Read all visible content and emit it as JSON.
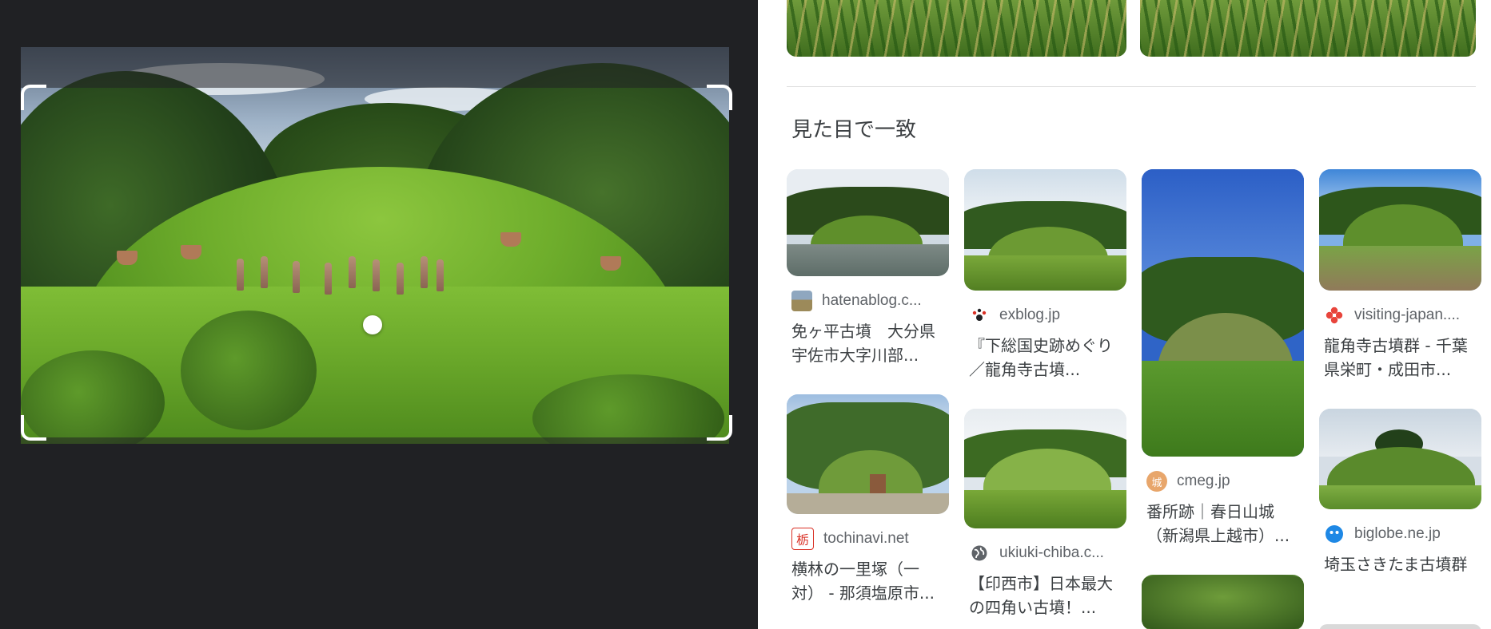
{
  "section": {
    "title": "見た目で一致"
  },
  "results": [
    {
      "source": "hatenablog.c...",
      "title": "免ヶ平古墳　大分県宇佐市大字川部...",
      "favicon": "landscape-favicon-icon"
    },
    {
      "source": "exblog.jp",
      "title": "『下総国史跡めぐり／龍角寺古墳...",
      "favicon": "paw-favicon-icon"
    },
    {
      "source": "cmeg.jp",
      "title": "番所跡｜春日山城（新潟県上越市）...",
      "favicon": "castle-favicon-icon",
      "favicon_text": "城"
    },
    {
      "source": "visiting-japan....",
      "title": "龍角寺古墳群 - 千葉県栄町・成田市...",
      "favicon": "flower-favicon-icon"
    },
    {
      "source": "tochinavi.net",
      "title": "横林の一里塚（一対） - 那須塩原市...",
      "favicon": "tochigi-favicon-icon",
      "favicon_text": "栃"
    },
    {
      "source": "ukiuki-chiba.c...",
      "title": "【印西市】日本最大の四角い古墳！...",
      "favicon": "globe-icon"
    },
    {
      "source": "biglobe.ne.jp",
      "title": "埼玉さきたま古墳群",
      "favicon": "biglobe-favicon-icon"
    }
  ],
  "colors": {
    "left_background": "#202124",
    "crop_handles": "#ffffff",
    "text_primary": "#3c4043",
    "text_secondary": "#5f6368"
  }
}
